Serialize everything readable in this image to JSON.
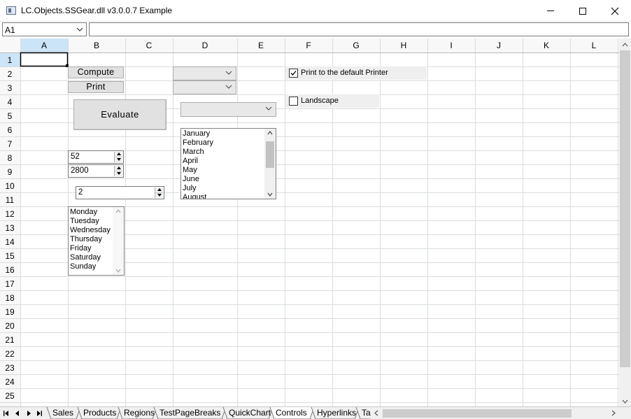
{
  "window": {
    "title": "LC.Objects.SSGear.dll v3.0.0.7 Example",
    "icons": [
      "app-icon",
      "minimize-icon",
      "maximize-icon",
      "close-icon"
    ]
  },
  "formula_bar": {
    "name_box": "A1",
    "formula": ""
  },
  "grid": {
    "columns": [
      "A",
      "B",
      "C",
      "D",
      "E",
      "F",
      "G",
      "H",
      "I",
      "J",
      "K",
      "L"
    ],
    "rows": [
      "1",
      "2",
      "3",
      "4",
      "5",
      "6",
      "7",
      "8",
      "9",
      "10",
      "11",
      "12",
      "13",
      "14",
      "15",
      "16",
      "17",
      "18",
      "19",
      "20",
      "21",
      "22",
      "23",
      "24",
      "25"
    ],
    "selected_cell": "A1",
    "colors": {
      "gridline": "#dadcdd",
      "header_bg": "#f8f8f8",
      "selected_header": "#cce4f7",
      "selected_header_text": "#000000"
    }
  },
  "controls": {
    "compute_label": "Compute",
    "print_label": "Print",
    "evaluate_label": "Evaluate",
    "spin1_value": "52",
    "spin2_value": "2800",
    "spin3_value": "2",
    "months": [
      "January",
      "February",
      "March",
      "April",
      " May",
      "June",
      "July",
      "August"
    ],
    "days": [
      "Monday",
      "Tuesday",
      "Wednesday",
      "Thursday",
      "Friday",
      "Saturday",
      "Sunday"
    ],
    "checkbox_print_label": "Print to the default Printer",
    "checkbox_print_checked": true,
    "checkbox_landscape_label": "Landscape",
    "checkbox_landscape_checked": false
  },
  "sheet_tabs": {
    "tabs": [
      "Sales",
      "Products",
      "Regions",
      "TestPageBreaks",
      "QuickChart",
      "Controls",
      "Hyperlinks",
      "Targ"
    ],
    "active": "Controls"
  }
}
